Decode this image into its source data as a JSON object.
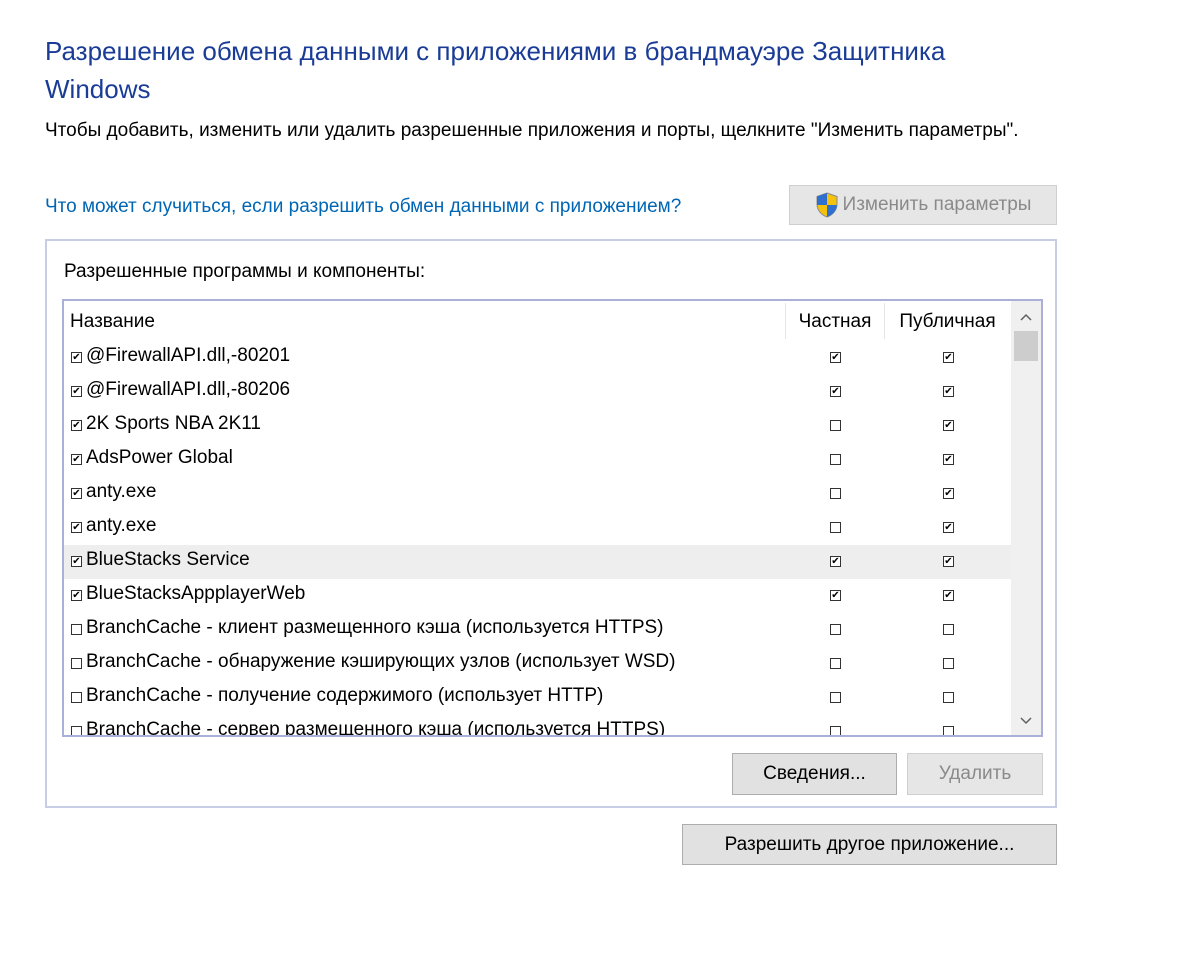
{
  "title": "Разрешение обмена данными с приложениями в брандмауэре Защитника Windows",
  "description": "Чтобы добавить, изменить или удалить разрешенные приложения и порты, щелкните \"Изменить параметры\".",
  "help_link": "Что может случиться, если разрешить обмен данными с приложением?",
  "change_settings_button": {
    "label": "Изменить параметры",
    "icon": "uac-shield-icon",
    "disabled": true
  },
  "group": {
    "label": "Разрешенные программы и компоненты:",
    "columns": {
      "name": "Название",
      "private": "Частная",
      "public": "Публичная"
    },
    "rows": [
      {
        "name": "@FirewallAPI.dll,-80201",
        "enabled": true,
        "private": true,
        "public": true
      },
      {
        "name": "@FirewallAPI.dll,-80206",
        "enabled": true,
        "private": true,
        "public": true
      },
      {
        "name": "2K Sports NBA 2K11",
        "enabled": true,
        "private": false,
        "public": true
      },
      {
        "name": "AdsPower Global",
        "enabled": true,
        "private": false,
        "public": true
      },
      {
        "name": "anty.exe",
        "enabled": true,
        "private": false,
        "public": true
      },
      {
        "name": "anty.exe",
        "enabled": true,
        "private": false,
        "public": true
      },
      {
        "name": "BlueStacks Service",
        "enabled": true,
        "private": true,
        "public": true,
        "selected": true
      },
      {
        "name": "BlueStacksAppplayerWeb",
        "enabled": true,
        "private": true,
        "public": true
      },
      {
        "name": "BranchCache - клиент размещенного кэша (используется HTTPS)",
        "enabled": false,
        "private": false,
        "public": false
      },
      {
        "name": "BranchCache - обнаружение кэширующих узлов (использует WSD)",
        "enabled": false,
        "private": false,
        "public": false
      },
      {
        "name": "BranchCache - получение содержимого (использует HTTP)",
        "enabled": false,
        "private": false,
        "public": false
      },
      {
        "name": "BranchCache - сервер размещенного кэша (используется HTTPS)",
        "enabled": false,
        "private": false,
        "public": false
      }
    ],
    "details_button": "Сведения...",
    "remove_button": "Удалить"
  },
  "allow_another_button": "Разрешить другое приложение..."
}
